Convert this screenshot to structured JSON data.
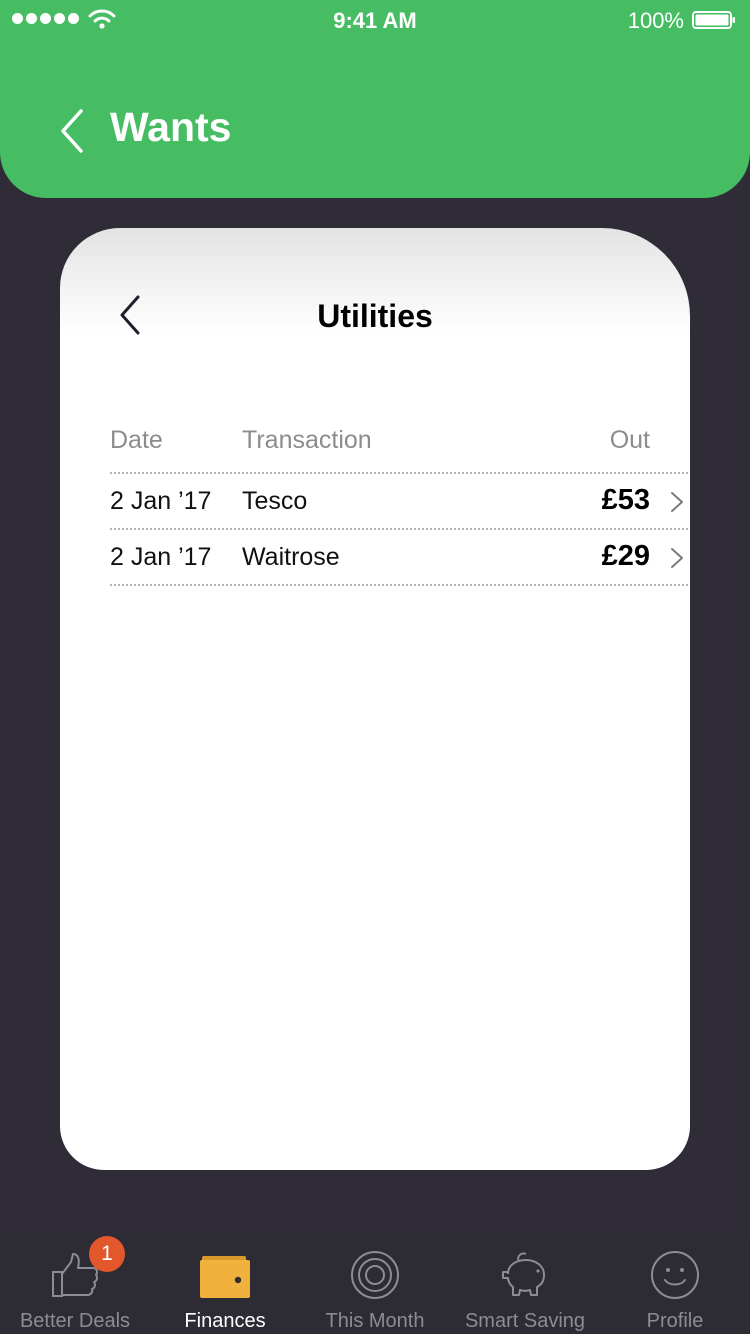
{
  "status_bar": {
    "time": "9:41 AM",
    "battery": "100%"
  },
  "header": {
    "title": "Wants"
  },
  "card": {
    "title": "Utilities",
    "columns": {
      "date": "Date",
      "transaction": "Transaction",
      "out": "Out"
    },
    "rows": [
      {
        "date": "2 Jan ’17",
        "transaction": "Tesco",
        "out": "£53"
      },
      {
        "date": "2 Jan ’17",
        "transaction": "Waitrose",
        "out": "£29"
      }
    ]
  },
  "tabs": [
    {
      "label": "Better Deals",
      "icon": "thumbs-up-icon",
      "badge": "1"
    },
    {
      "label": "Finances",
      "icon": "wallet-icon",
      "active": true
    },
    {
      "label": "This Month",
      "icon": "target-icon"
    },
    {
      "label": "Smart Saving",
      "icon": "piggy-bank-icon"
    },
    {
      "label": "Profile",
      "icon": "smiley-icon"
    }
  ],
  "colors": {
    "accent": "#47bd63",
    "background": "#2f2c37",
    "badge": "#e2572c",
    "active_icon": "#f0b23c"
  }
}
